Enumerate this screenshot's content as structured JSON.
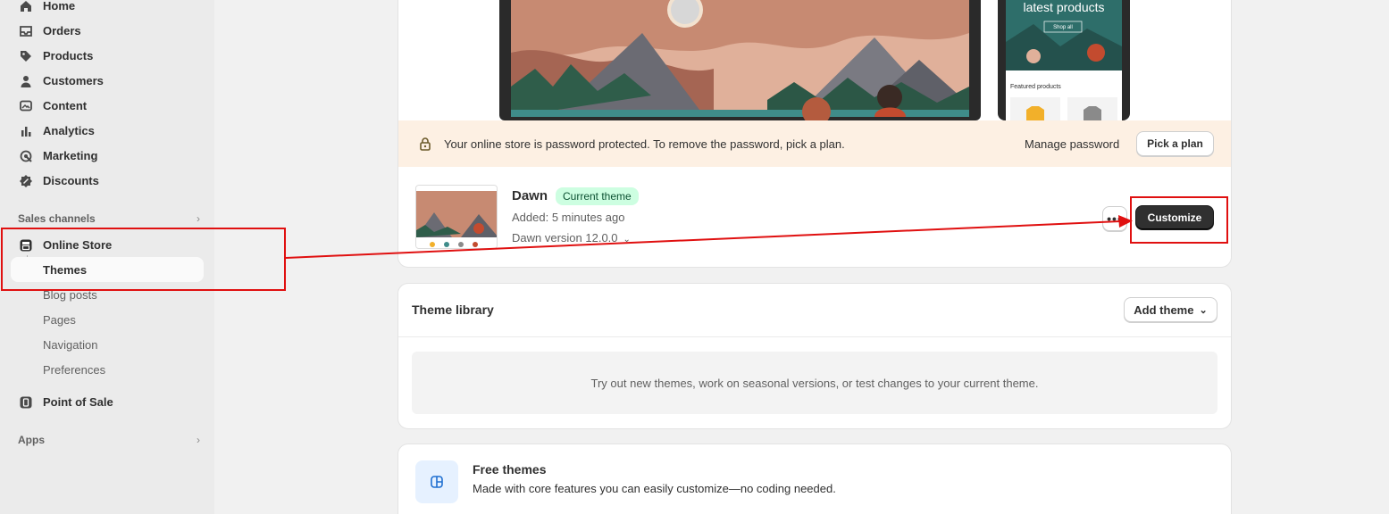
{
  "sidebar": {
    "items": [
      {
        "label": "Home",
        "icon": "home-icon"
      },
      {
        "label": "Orders",
        "icon": "inbox-icon"
      },
      {
        "label": "Products",
        "icon": "tag-icon"
      },
      {
        "label": "Customers",
        "icon": "person-icon"
      },
      {
        "label": "Content",
        "icon": "image-icon"
      },
      {
        "label": "Analytics",
        "icon": "bar-chart-icon"
      },
      {
        "label": "Marketing",
        "icon": "target-icon"
      },
      {
        "label": "Discounts",
        "icon": "discount-icon"
      }
    ],
    "sales_channels_label": "Sales channels",
    "online_store": {
      "label": "Online Store",
      "icon": "store-icon",
      "sub_items": [
        {
          "label": "Themes"
        },
        {
          "label": "Blog posts"
        },
        {
          "label": "Pages"
        },
        {
          "label": "Navigation"
        },
        {
          "label": "Preferences"
        }
      ]
    },
    "point_of_sale": {
      "label": "Point of Sale",
      "icon": "pos-icon"
    },
    "apps_label": "Apps"
  },
  "current_theme": {
    "preview": {
      "mobile_heading": "latest products",
      "mobile_button": "Shop all",
      "mobile_featured": "Featured products"
    },
    "password_banner": {
      "message": "Your online store is password protected. To remove the password, pick a plan.",
      "manage_label": "Manage password",
      "pick_plan_label": "Pick a plan"
    },
    "name": "Dawn",
    "badge": "Current theme",
    "added": "Added: 5 minutes ago",
    "version": "Dawn version 12.0.0",
    "more_label": "•••",
    "customize_label": "Customize"
  },
  "theme_library": {
    "title": "Theme library",
    "add_theme_label": "Add theme",
    "empty_text": "Try out new themes, work on seasonal versions, or test changes to your current theme."
  },
  "free_themes": {
    "title": "Free themes",
    "description": "Made with core features you can easily customize—no coding needed."
  },
  "colors": {
    "annotation": "#e01010",
    "primary_button": "#303030",
    "badge_bg": "#cdfee1",
    "banner_bg": "#fdf0e3"
  }
}
